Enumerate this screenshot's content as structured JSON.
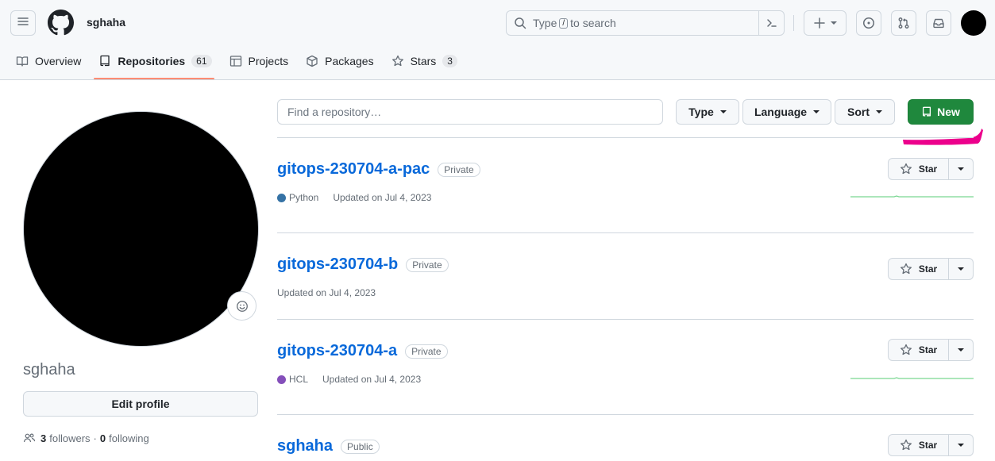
{
  "header": {
    "username": "sghaha",
    "search_prefix": "Type",
    "search_key": "/",
    "search_suffix": "to search"
  },
  "tabs": [
    {
      "label": "Overview"
    },
    {
      "label": "Repositories",
      "count": "61"
    },
    {
      "label": "Projects"
    },
    {
      "label": "Packages"
    },
    {
      "label": "Stars",
      "count": "3"
    }
  ],
  "profile": {
    "name": "sghaha",
    "edit_label": "Edit profile",
    "followers_count": "3",
    "followers_label": "followers",
    "separator": "·",
    "following_count": "0",
    "following_label": "following"
  },
  "toolbar": {
    "search_placeholder": "Find a repository…",
    "type_label": "Type",
    "language_label": "Language",
    "sort_label": "Sort",
    "new_label": "New"
  },
  "repos": [
    {
      "name": "gitops-230704-a-pac",
      "visibility": "Private",
      "language": "Python",
      "language_color": "#3572A5",
      "updated": "Updated on Jul 4, 2023",
      "star_label": "Star"
    },
    {
      "name": "gitops-230704-b",
      "visibility": "Private",
      "language": "",
      "updated": "Updated on Jul 4, 2023",
      "star_label": "Star"
    },
    {
      "name": "gitops-230704-a",
      "visibility": "Private",
      "language": "HCL",
      "language_color": "#844FBA",
      "updated": "Updated on Jul 4, 2023",
      "star_label": "Star"
    },
    {
      "name": "sghaha",
      "visibility": "Public",
      "star_label": "Star"
    }
  ],
  "colors": {
    "accent_green": "#1f883d",
    "link_blue": "#0969da",
    "tab_underline": "#fd8c73",
    "annotation_magenta": "#ec008c"
  }
}
